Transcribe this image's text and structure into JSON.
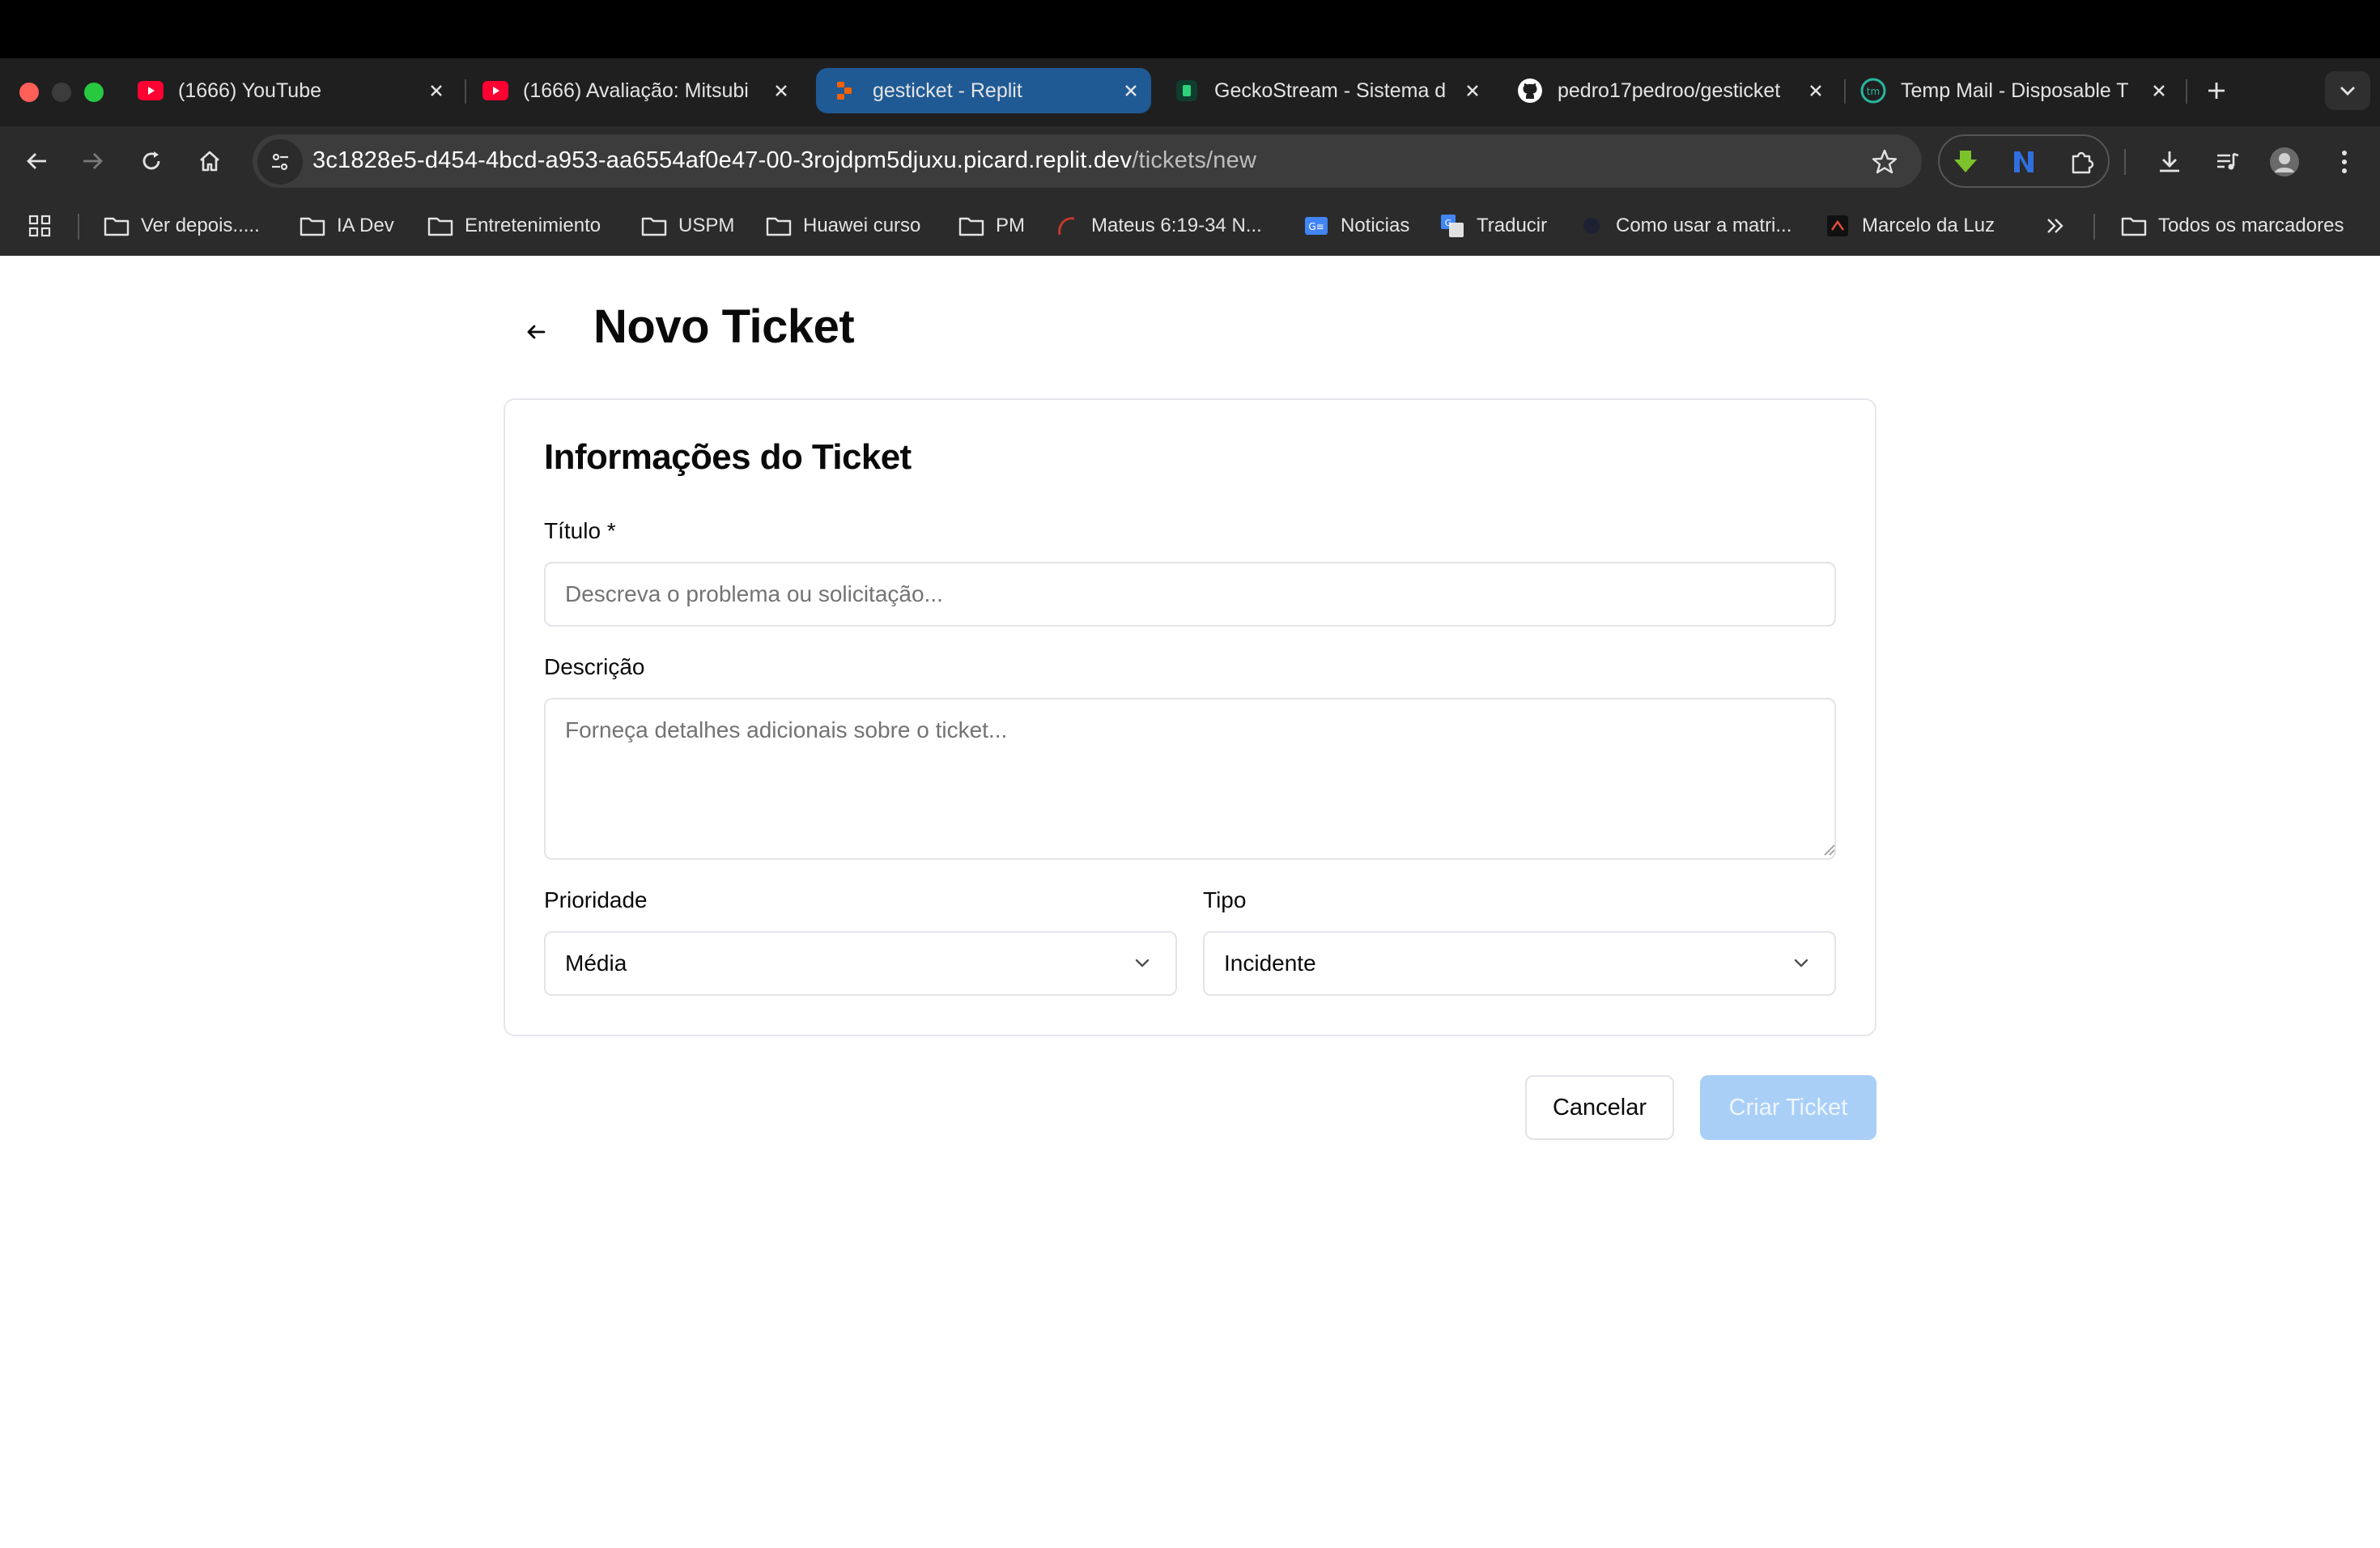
{
  "browser": {
    "tabs": [
      {
        "title": "(1666) YouTube",
        "icon": "youtube-icon",
        "active": false
      },
      {
        "title": "(1666) Avaliação: Mitsubi",
        "icon": "youtube-icon",
        "active": false
      },
      {
        "title": "gesticket - Replit",
        "icon": "replit-icon",
        "active": true
      },
      {
        "title": "GeckoStream - Sistema d",
        "icon": "geckostream-icon",
        "active": false
      },
      {
        "title": "pedro17pedroo/gesticket",
        "icon": "github-icon",
        "active": false
      },
      {
        "title": "Temp Mail - Disposable T",
        "icon": "tempmail-icon",
        "active": false
      }
    ],
    "url_host": "3c1828e5-d454-4bcd-a953-aa6554af0e47-00-3rojdpm5djuxu.picard.replit.dev",
    "url_path": "/tickets/new",
    "bookmarks": [
      {
        "label": "Ver depois.....",
        "icon": "folder-icon"
      },
      {
        "label": "IA Dev",
        "icon": "folder-icon"
      },
      {
        "label": "Entretenimiento",
        "icon": "folder-icon"
      },
      {
        "label": "USPM",
        "icon": "folder-icon"
      },
      {
        "label": "Huawei curso",
        "icon": "folder-icon"
      },
      {
        "label": "PM",
        "icon": "folder-icon"
      },
      {
        "label": "Mateus 6:19-34 N...",
        "icon": "site-icon"
      },
      {
        "label": "Noticias",
        "icon": "google-news-icon"
      },
      {
        "label": "Traducir",
        "icon": "google-translate-icon"
      },
      {
        "label": "Como usar a matri...",
        "icon": "site-icon"
      },
      {
        "label": "Marcelo da Luz",
        "icon": "site-icon"
      }
    ],
    "all_bookmarks": "Todos os marcadores"
  },
  "page": {
    "title": "Novo Ticket",
    "card_title": "Informações do Ticket",
    "title_label": "Título *",
    "title_placeholder": "Descreva o problema ou solicitação...",
    "description_label": "Descrição",
    "description_placeholder": "Forneça detalhes adicionais sobre o ticket...",
    "priority_label": "Prioridade",
    "priority_value": "Média",
    "type_label": "Tipo",
    "type_value": "Incidente",
    "cancel_label": "Cancelar",
    "create_label": "Criar Ticket"
  },
  "colors": {
    "active_tab": "#1f5a94",
    "create_button": "#a9cff7"
  }
}
